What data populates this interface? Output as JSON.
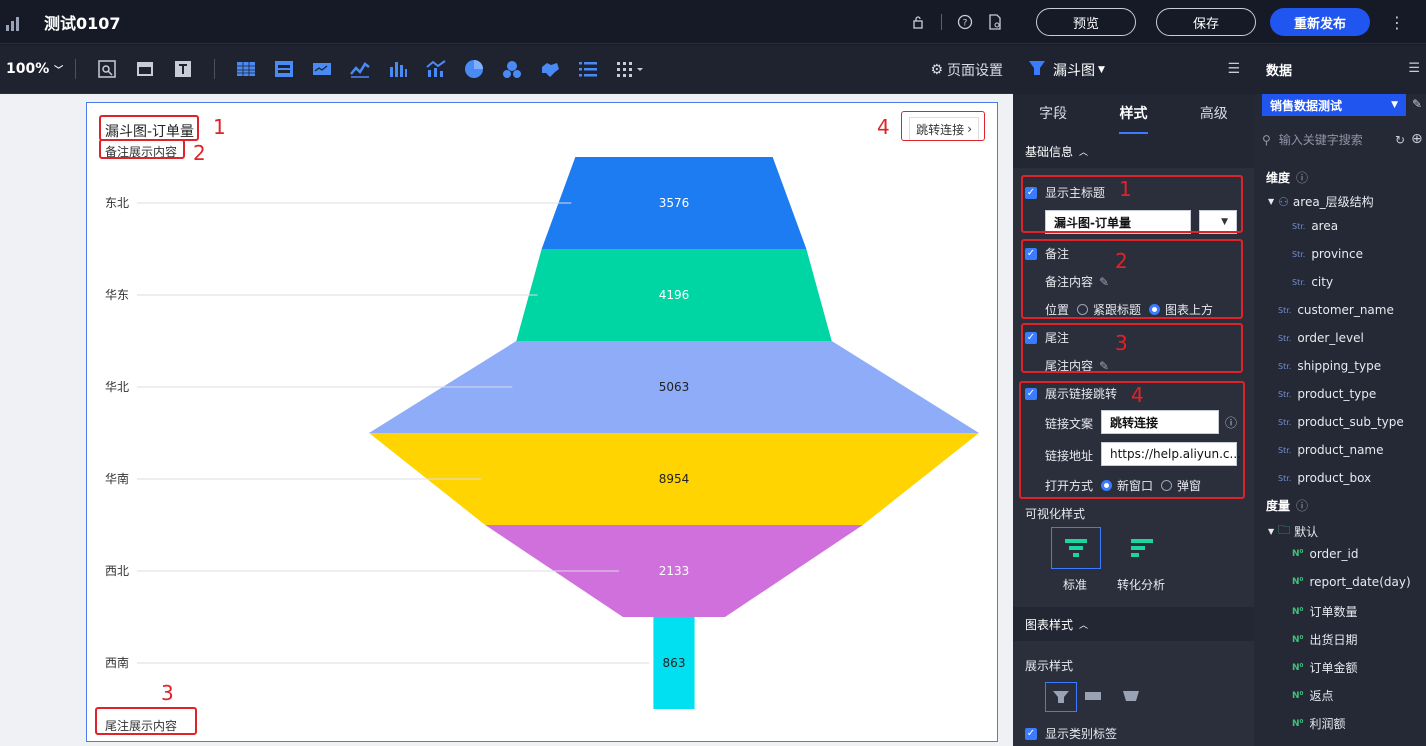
{
  "app": {
    "title": "测试0107",
    "preview": "预览",
    "save": "保存",
    "republish": "重新发布"
  },
  "toolbar": {
    "zoom": "100%",
    "page_settings": "页面设置"
  },
  "chart": {
    "title": "漏斗图-订单量",
    "note": "备注展示内容",
    "footer": "尾注展示内容",
    "link_text": "跳转连接",
    "annotations": [
      "1",
      "2",
      "3",
      "4"
    ]
  },
  "chart_data": {
    "type": "funnel",
    "categories": [
      "东北",
      "华东",
      "华北",
      "华南",
      "西北",
      "西南"
    ],
    "values": [
      3576,
      4196,
      5063,
      8954,
      2133,
      863
    ],
    "colors": [
      "#1e7cf2",
      "#00d6a4",
      "#8eacf8",
      "#ffd400",
      "#d070dc",
      "#00e0f0"
    ]
  },
  "panel": {
    "chart_type": "漏斗图",
    "tabs": [
      "字段",
      "样式",
      "高级"
    ],
    "basic_info": "基础信息",
    "show_title": "显示主标题",
    "title_value": "漏斗图-订单量",
    "note": "备注",
    "note_content": "备注内容",
    "position": "位置",
    "pos_opt1": "紧跟标题",
    "pos_opt2": "图表上方",
    "footer": "尾注",
    "footer_content": "尾注内容",
    "show_link": "展示链接跳转",
    "link_text_label": "链接文案",
    "link_text_value": "跳转连接",
    "link_url_label": "链接地址",
    "link_url_value": "https://help.aliyun.c...",
    "open_mode": "打开方式",
    "open_opt1": "新窗口",
    "open_opt2": "弹窗",
    "viz_style": "可视化样式",
    "viz_opt1": "标准",
    "viz_opt2": "转化分析",
    "chart_style": "图表样式",
    "display_style": "展示样式",
    "show_category_label": "显示类别标签"
  },
  "data_panel": {
    "title": "数据",
    "dataset": "销售数据测试",
    "search_placeholder": "输入关键字搜索",
    "dimension": "维度",
    "hierarchy": "area_层级结构",
    "dim_fields": [
      "area",
      "province",
      "city"
    ],
    "dim_fields2": [
      "customer_name",
      "order_level",
      "shipping_type",
      "product_type",
      "product_sub_type",
      "product_name",
      "product_box"
    ],
    "measure": "度量",
    "default_folder": "默认",
    "measures": [
      "order_id",
      "report_date(day)",
      "订单数量",
      "出货日期",
      "订单金额",
      "返点",
      "利润额"
    ]
  }
}
